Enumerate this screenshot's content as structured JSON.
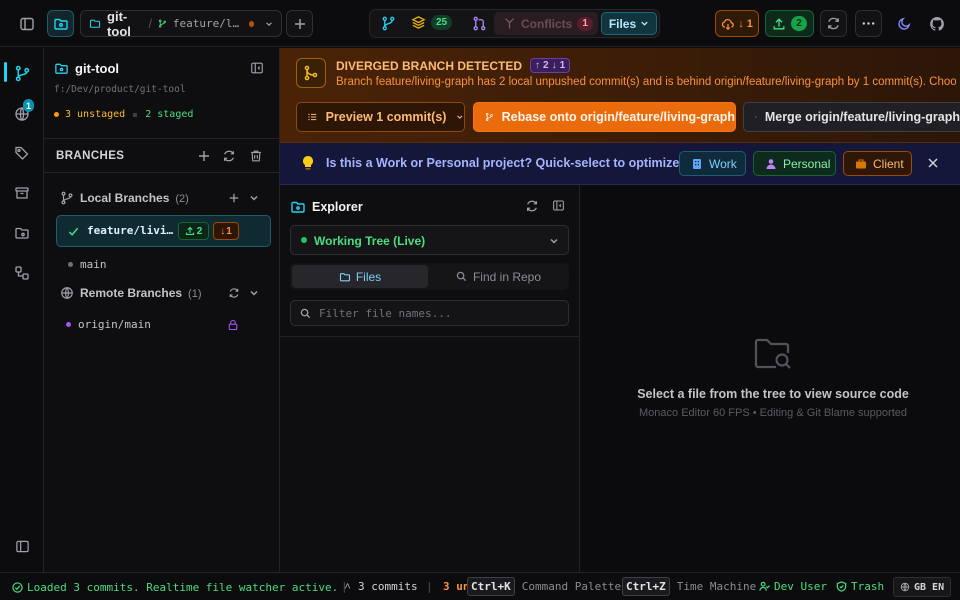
{
  "colors": {
    "accent": "#22d3ee",
    "warning": "#f97316",
    "success": "#4ade80",
    "conflict": "#e11d48"
  },
  "topbar": {
    "repo_name": "git-tool",
    "repo_separator": "/",
    "branch_short": "feature/l…",
    "stash_count": "25",
    "conflicts_label": "Conflicts",
    "conflicts_count": "1",
    "files_label": "Files",
    "pull_count": "1",
    "push_count": "2"
  },
  "rail": {
    "notification_badge": "1"
  },
  "sidebar": {
    "repo_title": "git-tool",
    "repo_path": "f:/Dev/product/git-tool",
    "unstaged": "3 unstaged",
    "staged": "2 staged",
    "branches_label": "BRANCHES",
    "local_label": "Local Branches",
    "local_count": "(2)",
    "active_branch": "feature/livi…",
    "active_ahead": "2",
    "active_behind": "1",
    "main_branch": "main",
    "remote_label": "Remote Branches",
    "remote_count": "(1)",
    "remote_branch": "origin/main"
  },
  "alert": {
    "title": "DIVERGED BRANCH DETECTED",
    "ahead": "2",
    "behind": "1",
    "message": "Branch feature/living-graph has 2 local unpushed commit(s) and is behind origin/feature/living-graph by 1 commit(s). Choo...",
    "preview_label": "Preview 1 commit(s)",
    "rebase_label": "Rebase onto origin/feature/living-graph",
    "merge_label": "Merge origin/feature/living-graph"
  },
  "notice": {
    "text": "Is this a Work or Personal project? Quick-select to optimize ...",
    "work": "Work",
    "personal": "Personal",
    "client": "Client"
  },
  "explorer": {
    "title": "Explorer",
    "source": "Working Tree (Live)",
    "tab_files": "Files",
    "tab_find": "Find in Repo",
    "filter_placeholder": "Filter file names..."
  },
  "viewer": {
    "title": "Select a file from the tree to view source code",
    "subtitle": "Monaco Editor 60 FPS • Editing & Git Blame supported"
  },
  "statusbar": {
    "message": "Loaded 3 commits. Realtime file watcher active.",
    "commits": "3 commits",
    "unstaged_trunc": "3 un",
    "kbd_palette": "Ctrl+K",
    "palette_label": "Command Palette",
    "kbd_time": "Ctrl+Z",
    "time_label": "Time Machine",
    "user": "Dev User",
    "trash": "Trash",
    "locale": "GB EN"
  }
}
